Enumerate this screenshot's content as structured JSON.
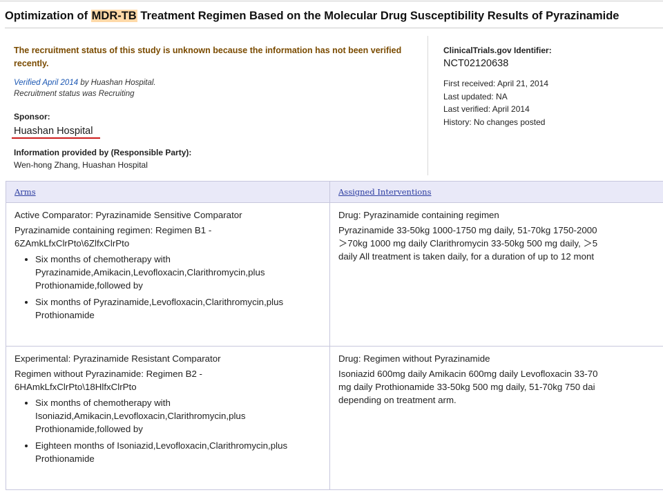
{
  "title": {
    "before": "Optimization of ",
    "highlight": "MDR-TB",
    "after": " Treatment Regimen Based on the Molecular Drug Susceptibility Results of Pyrazinamide"
  },
  "status": {
    "message": "The recruitment status of this study is unknown because the information has not been verified recently.",
    "verified_link": "Verified April 2014",
    "verified_by": " by Huashan Hospital.",
    "recruitment_status": "Recruitment status was  Recruiting"
  },
  "sponsor": {
    "label": "Sponsor:",
    "name": "Huashan Hospital"
  },
  "responsible_party": {
    "label": "Information provided by (Responsible Party):",
    "value": "Wen-hong Zhang, Huashan Hospital"
  },
  "identifier": {
    "label": "ClinicalTrials.gov Identifier:",
    "value": "NCT02120638",
    "first_received": "First received: April 21, 2014",
    "last_updated": "Last updated: NA",
    "last_verified": "Last verified: April 2014",
    "history": "History: No changes posted"
  },
  "table": {
    "headers": [
      "Arms",
      "Assigned Interventions"
    ],
    "rows": [
      {
        "arm_title": "Active Comparator: Pyrazinamide Sensitive Comparator",
        "arm_desc": "Pyrazinamide containing regimen: Regimen B1 - 6ZAmkLfxClrPto\\6ZlfxClrPto",
        "bullets": [
          "Six months of chemotherapy with Pyrazinamide,Amikacin,Levofloxacin,Clarithromycin,plus Prothionamide,followed by",
          "Six months of Pyrazinamide,Levofloxacin,Clarithromycin,plus Prothionamide"
        ],
        "intervention_title": "Drug: Pyrazinamide containing regimen",
        "intervention_lines": [
          "Pyrazinamide 33-50kg 1000-1750 mg daily, 51-70kg 1750-2000",
          "＞70kg 1000 mg daily Clarithromycin 33-50kg 500 mg daily, ＞5",
          "daily All treatment is taken daily, for a duration of up to 12 mont"
        ]
      },
      {
        "arm_title": "Experimental: Pyrazinamide Resistant Comparator",
        "arm_desc": "Regimen without Pyrazinamide: Regimen B2 - 6HAmkLfxClrPto\\18HlfxClrPto",
        "bullets": [
          "Six months of chemotherapy with Isoniazid,Amikacin,Levofloxacin,Clarithromycin,plus Prothionamide,followed by",
          "Eighteen months of Isoniazid,Levofloxacin,Clarithromycin,plus Prothionamide"
        ],
        "intervention_title": "Drug: Regimen without Pyrazinamide",
        "intervention_lines": [
          "Isoniazid 600mg daily Amikacin 600mg daily Levofloxacin 33-70",
          "mg daily Prothionamide 33-50kg 500 mg daily, 51-70kg 750 dai",
          "depending on treatment arm."
        ]
      }
    ]
  },
  "colors": {
    "status_text": "#7a4b00",
    "link": "#1b57b3",
    "title_highlight": "#ffd9a8",
    "table_header_bg": "#e9e9f8",
    "sponsor_underline": "#cc1b1b"
  }
}
